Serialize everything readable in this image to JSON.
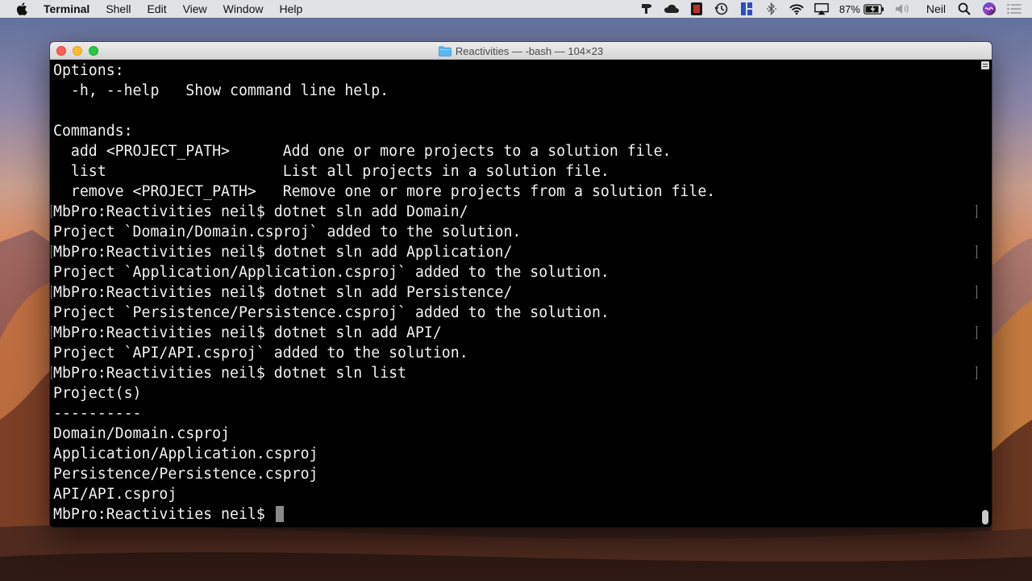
{
  "menubar": {
    "items": [
      "Terminal",
      "Shell",
      "Edit",
      "View",
      "Window",
      "Help"
    ],
    "battery_percent": "87%",
    "user": "Neil"
  },
  "window": {
    "title": "Reactivities — -bash — 104×23"
  },
  "terminal": {
    "lines": [
      "Options:",
      "  -h, --help   Show command line help.",
      "",
      "Commands:",
      "  add <PROJECT_PATH>      Add one or more projects to a solution file.",
      "  list                    List all projects in a solution file.",
      "  remove <PROJECT_PATH>   Remove one or more projects from a solution file.",
      "MbPro:Reactivities neil$ dotnet sln add Domain/",
      "Project `Domain/Domain.csproj` added to the solution.",
      "MbPro:Reactivities neil$ dotnet sln add Application/",
      "Project `Application/Application.csproj` added to the solution.",
      "MbPro:Reactivities neil$ dotnet sln add Persistence/",
      "Project `Persistence/Persistence.csproj` added to the solution.",
      "MbPro:Reactivities neil$ dotnet sln add API/",
      "Project `API/API.csproj` added to the solution.",
      "MbPro:Reactivities neil$ dotnet sln list",
      "Project(s)",
      "----------",
      "Domain/Domain.csproj",
      "Application/Application.csproj",
      "Persistence/Persistence.csproj",
      "API/API.csproj",
      "MbPro:Reactivities neil$ "
    ]
  },
  "icons": {
    "status": [
      "input-icon",
      "creative-cloud-icon",
      "screen-record-icon",
      "time-machine-icon",
      "app-icon",
      "bluetooth-icon",
      "wifi-icon",
      "airplay-icon",
      "battery-icon",
      "volume-icon",
      "spotlight-search-icon",
      "siri-icon",
      "notification-center-icon"
    ]
  },
  "colors": {
    "terminal_bg": "#000000",
    "terminal_fg": "#f2f2f2",
    "close": "#fc5f57",
    "minimize": "#fdbc2e",
    "maximize": "#28c840"
  }
}
